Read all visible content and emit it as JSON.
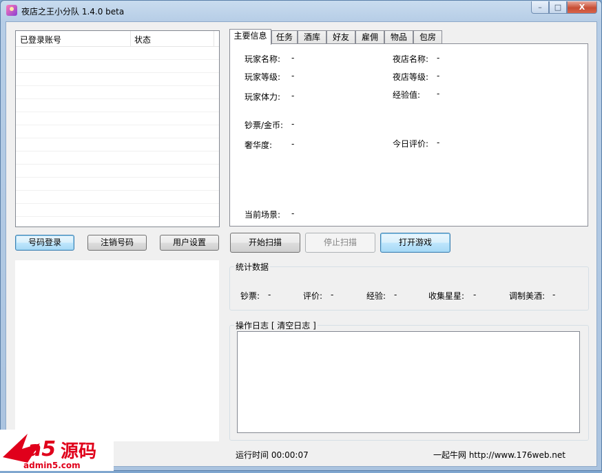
{
  "window": {
    "title": "夜店之王小分队 1.4.0 beta",
    "buttons": {
      "minimize": "–",
      "maximize": "□",
      "close": "X"
    }
  },
  "accounts_list": {
    "columns": [
      "已登录账号",
      "状态"
    ],
    "rows": []
  },
  "left_buttons": {
    "login": "号码登录",
    "logout": "注销号码",
    "settings": "用户设置"
  },
  "tabs": [
    "主要信息",
    "任务",
    "酒库",
    "好友",
    "雇佣",
    "物品",
    "包房"
  ],
  "main_info": {
    "player_name": {
      "label": "玩家名称:",
      "value": "-"
    },
    "club_name": {
      "label": "夜店名称:",
      "value": "-"
    },
    "player_level": {
      "label": "玩家等级:",
      "value": "-"
    },
    "club_level": {
      "label": "夜店等级:",
      "value": "-"
    },
    "player_stamina": {
      "label": "玩家体力:",
      "value": "-"
    },
    "experience": {
      "label": "经验值:",
      "value": "-"
    },
    "cash_gold": {
      "label": "钞票/金币:",
      "value": "-"
    },
    "luxury": {
      "label": "奢华度:",
      "value": "-"
    },
    "today_rating": {
      "label": "今日评价:",
      "value": "-"
    },
    "current_scene": {
      "label": "当前场景:",
      "value": "-"
    }
  },
  "action_buttons": {
    "start_scan": "开始扫描",
    "stop_scan": "停止扫描",
    "open_game": "打开游戏"
  },
  "stats": {
    "title": "统计数据",
    "items": [
      {
        "label": "钞票:",
        "value": "-"
      },
      {
        "label": "评价:",
        "value": "-"
      },
      {
        "label": "经验:",
        "value": "-"
      },
      {
        "label": "收集星星:",
        "value": "-"
      },
      {
        "label": "调制美酒:",
        "value": "-"
      }
    ]
  },
  "log": {
    "title": "操作日志 [ 清空日志 ]",
    "content": ""
  },
  "status_bar": {
    "runtime": "运行时间 00:00:07",
    "site": "一起牛网 http://www.176web.net"
  },
  "watermark": {
    "brand": "a5源码",
    "url": "admin5.com"
  },
  "colors": {
    "window_frame": "#b6cde6",
    "client_bg": "#f0f0f0",
    "close_button": "#c74e35",
    "default_button_border": "#3c7fb1",
    "watermark_red": "#e0001b"
  }
}
